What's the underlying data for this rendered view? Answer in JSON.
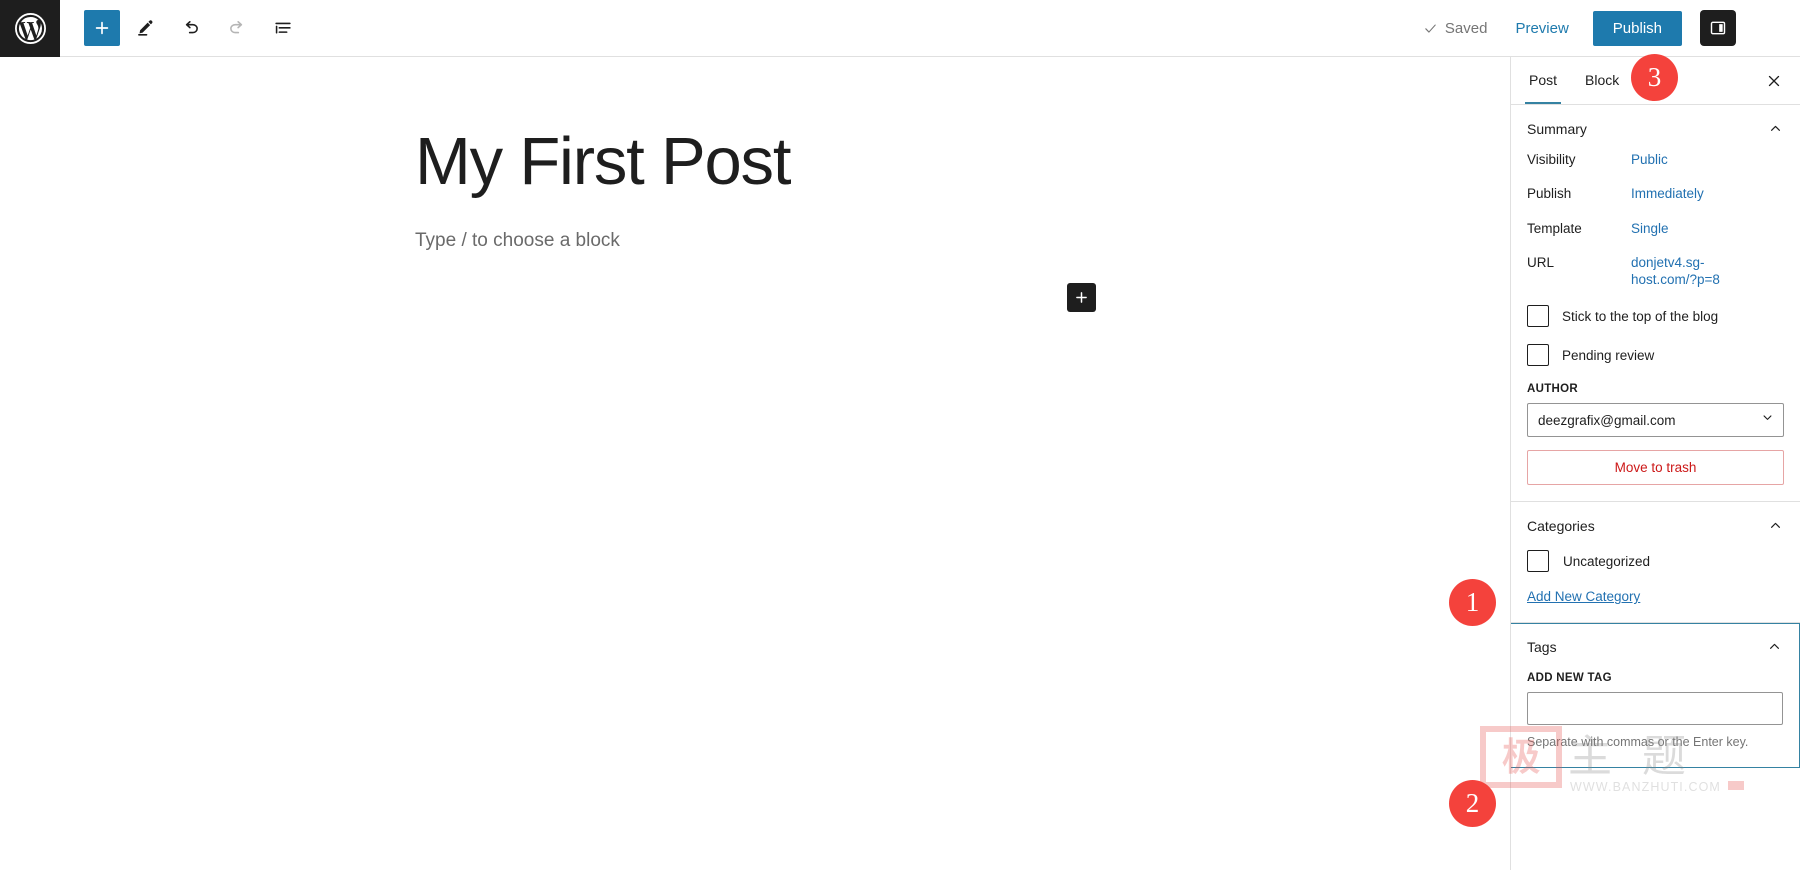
{
  "topbar": {
    "logo_icon": "wordpress-logo-icon",
    "tools": [
      {
        "name": "block-inserter",
        "icon": "plus-icon",
        "label": "Toggle block inserter",
        "variant": "primary"
      },
      {
        "name": "tools-pencil",
        "icon": "pencil-icon",
        "label": "Tools",
        "variant": "default"
      },
      {
        "name": "undo",
        "icon": "undo-arrow-icon",
        "label": "Undo",
        "variant": "default"
      },
      {
        "name": "redo",
        "icon": "redo-arrow-icon",
        "label": "Redo",
        "variant": "disabled"
      },
      {
        "name": "list-view",
        "icon": "list-view-icon",
        "label": "Document Overview",
        "variant": "default"
      }
    ],
    "saved_label": "Saved",
    "saved_icon": "checkmark-icon",
    "preview_label": "Preview",
    "publish_label": "Publish",
    "sidebar_toggle_icon": "settings-panel-icon",
    "kebab_icon": "more-options-icon"
  },
  "editor": {
    "title": "My First Post",
    "block_placeholder": "Type / to choose a block",
    "inserter_icon": "plus-icon"
  },
  "sidebar": {
    "tabs": [
      {
        "label": "Post",
        "active": true
      },
      {
        "label": "Block",
        "active": false
      }
    ],
    "close_icon": "close-icon",
    "summary": {
      "title": "Summary",
      "chevron_icon": "chevron-up-icon",
      "rows": [
        {
          "label": "Visibility",
          "value": "Public"
        },
        {
          "label": "Publish",
          "value": "Immediately"
        },
        {
          "label": "Template",
          "value": "Single"
        },
        {
          "label": "URL",
          "value": "donjetv4.sg-host.com/?p=8"
        }
      ],
      "checkboxes": [
        {
          "label": "Stick to the top of the blog",
          "checked": false
        },
        {
          "label": "Pending review",
          "checked": false
        }
      ],
      "author_label": "AUTHOR",
      "author_value": "deezgrafix@gmail.com",
      "author_chevron_icon": "chevron-down-icon",
      "trash_label": "Move to trash"
    },
    "categories": {
      "title": "Categories",
      "chevron_icon": "chevron-up-icon",
      "items": [
        {
          "label": "Uncategorized",
          "checked": false
        }
      ],
      "add_new_label": "Add New Category"
    },
    "tags": {
      "title": "Tags",
      "chevron_icon": "chevron-up-icon",
      "field_label": "ADD NEW TAG",
      "input_value": "",
      "input_placeholder": "",
      "help_text": "Separate with commas or the Enter key."
    }
  },
  "badges": [
    {
      "number": "1"
    },
    {
      "number": "2"
    },
    {
      "number": "3"
    }
  ],
  "watermark": {
    "seal_char": "极",
    "chars": "主 题",
    "url": "WWW.BANZHUTI.COM"
  },
  "colors": {
    "accent": "#1e7aad",
    "link": "#2271b1",
    "badge": "#f4423c",
    "danger": "#cc1818",
    "tab_active": "#3582a2"
  }
}
